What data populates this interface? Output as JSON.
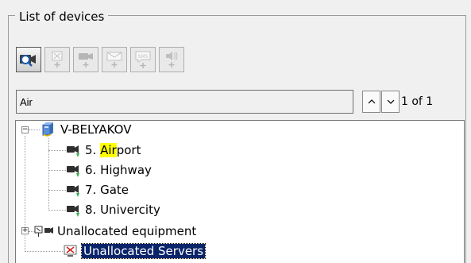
{
  "panel": {
    "title": "List of devices"
  },
  "toolbar": {
    "buttons": [
      {
        "icon": "camera-search-icon",
        "state": "active"
      },
      {
        "icon": "add-sensor-icon",
        "state": "disabled"
      },
      {
        "icon": "add-camera-icon",
        "state": "disabled"
      },
      {
        "icon": "add-email-icon",
        "state": "disabled"
      },
      {
        "icon": "add-sms-icon",
        "state": "disabled",
        "label": "SMS"
      },
      {
        "icon": "add-speaker-icon",
        "state": "disabled"
      }
    ]
  },
  "search": {
    "value": "Air",
    "result_counter": "1 of 1"
  },
  "tree": {
    "server": {
      "label": "V-BELYAKOV",
      "expander": "−"
    },
    "cameras": [
      {
        "prefix": "5. ",
        "match": "Air",
        "rest": "port"
      },
      {
        "label": "6. Highway"
      },
      {
        "label": "7. Gate"
      },
      {
        "label": "8. Univercity"
      }
    ],
    "unallocated_equipment": {
      "label": "Unallocated equipment",
      "expander": "+"
    },
    "unallocated_servers": {
      "label": "Unallocated Servers",
      "selected": true
    }
  },
  "colors": {
    "selection": "#0a246a",
    "match_highlight": "#ffff00",
    "status_green": "#2bb04a"
  }
}
